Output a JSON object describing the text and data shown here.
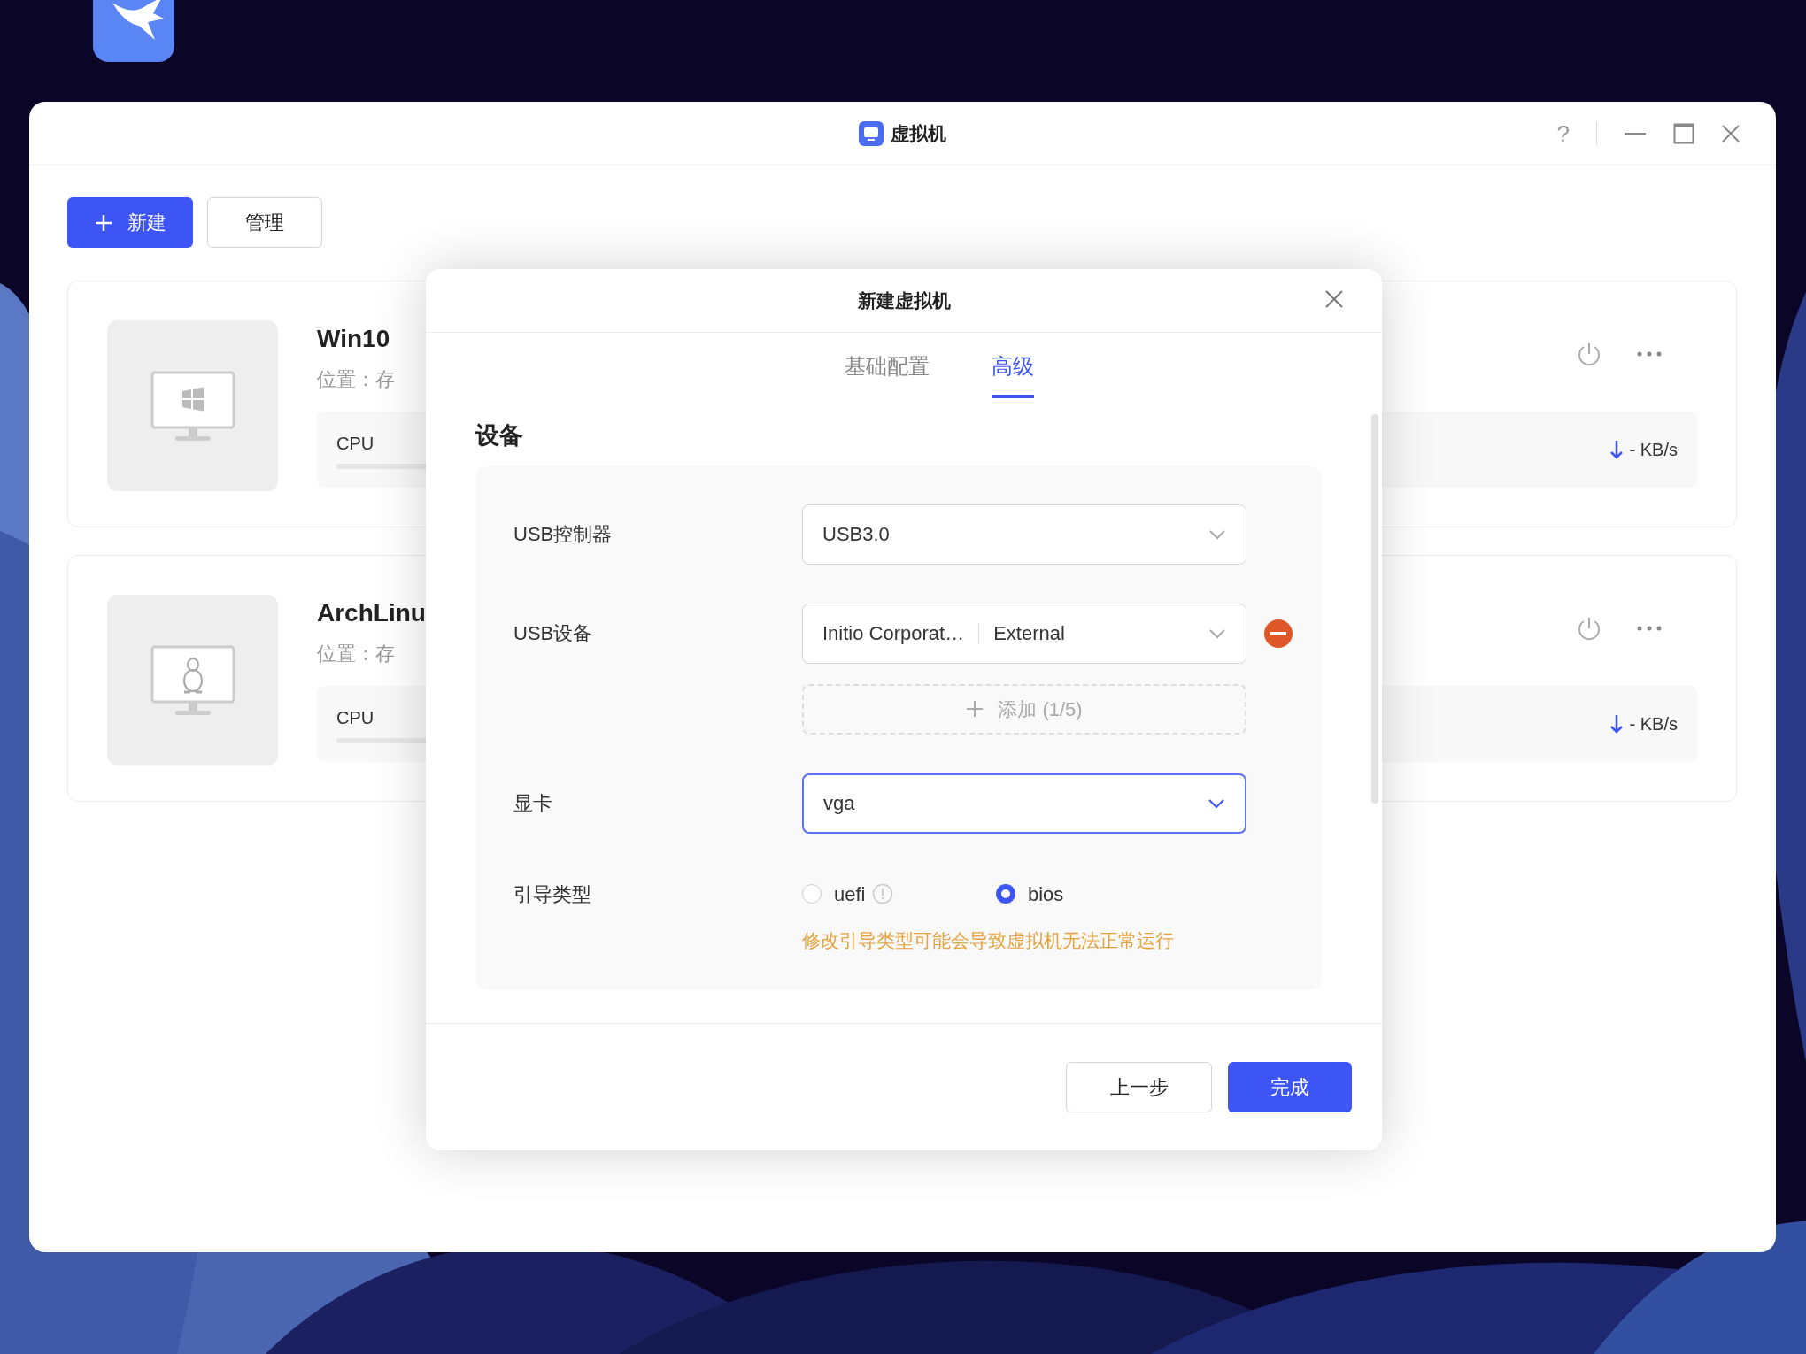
{
  "window": {
    "title": "虚拟机",
    "help": "?"
  },
  "toolbar": {
    "buttons": [
      {
        "label": "新建",
        "kind": "primary"
      },
      {
        "label": "管理",
        "kind": "default"
      }
    ]
  },
  "vms": [
    {
      "name": "Win10",
      "kind": "windows",
      "location": "位置：存",
      "stat_label": "CPU",
      "network": "- KB/s"
    },
    {
      "name": "ArchLinu",
      "kind": "linux",
      "location": "位置：存",
      "stat_label": "CPU",
      "network": "- KB/s"
    }
  ],
  "dialog": {
    "title": "新建虚拟机",
    "tabs": [
      {
        "label": "基础配置",
        "selected": false
      },
      {
        "label": "高级",
        "selected": true
      }
    ],
    "section": "设备",
    "fields": [
      {
        "kind": "select",
        "label": "USB控制器",
        "value": "USB3.0",
        "focused": false
      },
      {
        "kind": "devices",
        "label": "USB设备",
        "devices": [
          {
            "name": "Initio Corporat…",
            "type": "External"
          }
        ],
        "add": "添加 (1/5)"
      },
      {
        "kind": "select",
        "label": "显卡",
        "value": "vga",
        "focused": true
      },
      {
        "kind": "radio",
        "label": "引导类型",
        "options": [
          {
            "label": "uefi",
            "selected": false,
            "info": true
          },
          {
            "label": "bios",
            "selected": true,
            "info": false
          }
        ],
        "warning": "修改引导类型可能会导致虚拟机无法正常运行"
      }
    ],
    "buttons": [
      {
        "label": "上一步",
        "kind": "default"
      },
      {
        "label": "完成",
        "kind": "primary"
      }
    ]
  }
}
